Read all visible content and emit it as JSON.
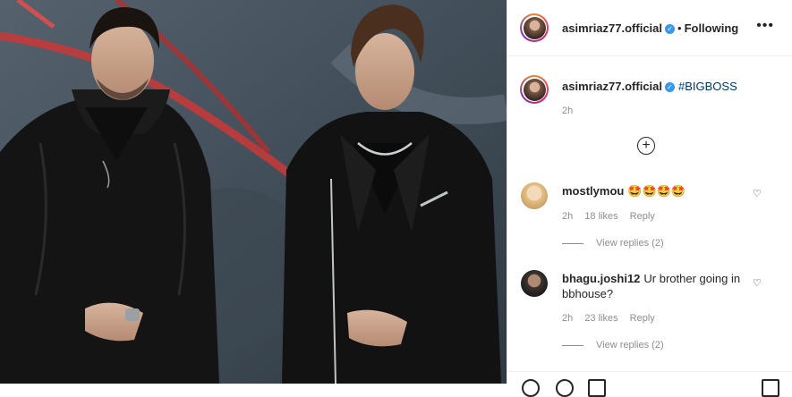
{
  "post": {
    "image_description_label": "",
    "owner": {
      "username": "asimriaz77.official",
      "verified": true,
      "follow_status": "Following"
    },
    "caption": {
      "username": "asimriaz77.official",
      "text": "#BIGBOSS",
      "time": "2h"
    },
    "comments": [
      {
        "username": "mostlymou",
        "text": "🤩🤩🤩🤩",
        "time": "2h",
        "likes": "18 likes",
        "reply_label": "Reply",
        "view_replies": "View replies (2)"
      },
      {
        "username": "bhagu.joshi12",
        "text": "Ur brother going in bbhouse?",
        "time": "2h",
        "likes": "23 likes",
        "reply_label": "Reply",
        "view_replies": "View replies (2)"
      }
    ]
  },
  "icons": {
    "more": "more-options-icon",
    "verified": "verified-badge-icon",
    "load_more": "plus-circle-icon",
    "like": "heart-icon",
    "comment": "comment-icon"
  },
  "colors": {
    "link": "#00376b",
    "muted": "#8e8e8e",
    "verified": "#3897f0"
  },
  "dot": "•",
  "more_glyph": "•••",
  "plus_glyph": "+",
  "heart_glyph": "♡",
  "check_glyph": "✓"
}
